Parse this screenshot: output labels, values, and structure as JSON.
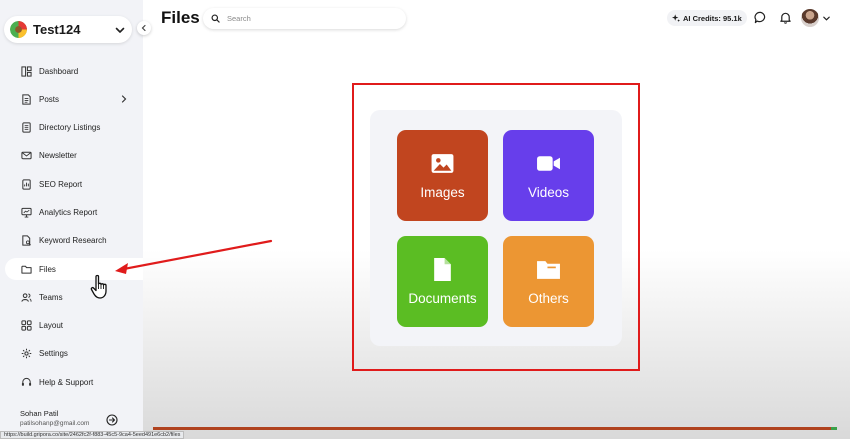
{
  "workspace": {
    "name": "Test124"
  },
  "sidebar": {
    "items": [
      {
        "label": "Dashboard",
        "icon": "dashboard-icon"
      },
      {
        "label": "Posts",
        "icon": "posts-icon"
      },
      {
        "label": "Directory Listings",
        "icon": "directory-icon"
      },
      {
        "label": "Newsletter",
        "icon": "newsletter-icon"
      },
      {
        "label": "SEO Report",
        "icon": "seo-report-icon"
      },
      {
        "label": "Analytics Report",
        "icon": "analytics-icon"
      },
      {
        "label": "Keyword Research",
        "icon": "keyword-research-icon"
      },
      {
        "label": "Files",
        "icon": "folder-icon",
        "active": true
      },
      {
        "label": "Teams",
        "icon": "teams-icon"
      },
      {
        "label": "Layout",
        "icon": "layout-icon"
      },
      {
        "label": "Settings",
        "icon": "settings-icon"
      },
      {
        "label": "Help & Support",
        "icon": "help-icon"
      }
    ],
    "user": {
      "name": "Sohan Patil",
      "email": "patilsohanp@gmail.com"
    }
  },
  "header": {
    "title": "Files",
    "search_placeholder": "Search",
    "ai_credits": "AI Credits: 95.1k"
  },
  "files": {
    "tiles": [
      {
        "label": "Images",
        "color": "#c1451f",
        "icon": "image-icon"
      },
      {
        "label": "Videos",
        "color": "#673eeb",
        "icon": "video-icon"
      },
      {
        "label": "Documents",
        "color": "#5bbd23",
        "icon": "document-icon"
      },
      {
        "label": "Others",
        "color": "#ec9633",
        "icon": "folder-icon"
      }
    ]
  },
  "status_url": "https://build.gripora.co/site/2462fc2f-f883-45c5-9ca4-5eed491e6cb2/files",
  "colors": {
    "accent": "#c1451f",
    "annotation": "#e01b1b",
    "sidebar_bg": "#f2f3f7"
  }
}
